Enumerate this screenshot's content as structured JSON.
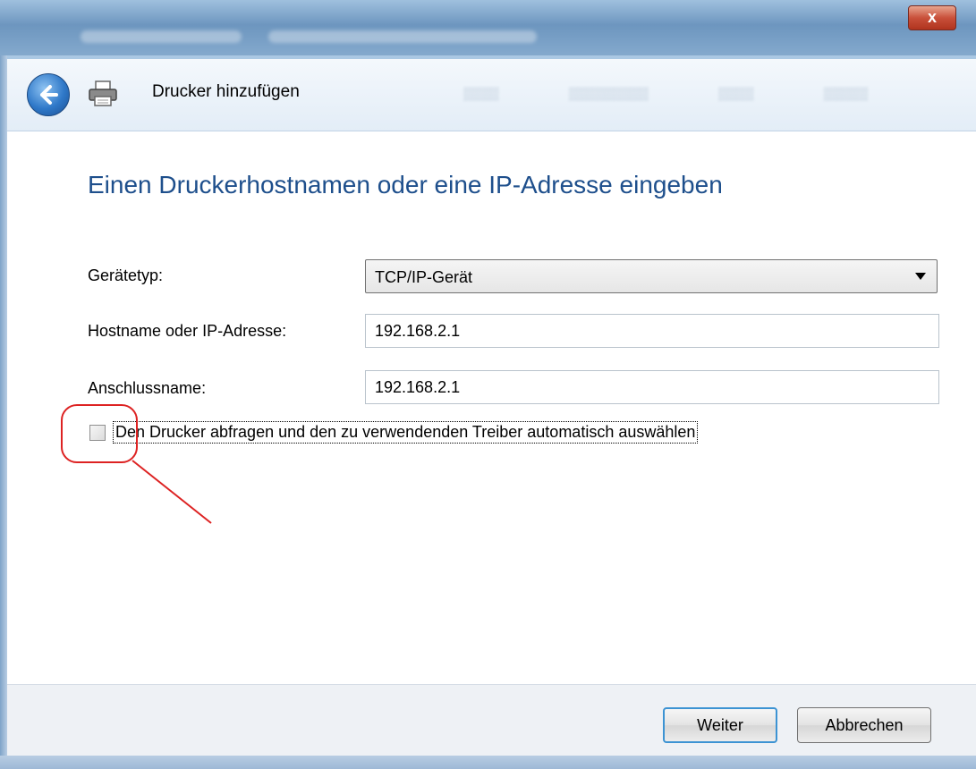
{
  "window": {
    "close_label": "x"
  },
  "nav": {
    "title": "Drucker hinzufügen"
  },
  "main": {
    "heading": "Einen Druckerhostnamen oder eine IP-Adresse eingeben",
    "device_type": {
      "label": "Gerätetyp:",
      "selected": "TCP/IP-Gerät"
    },
    "hostname": {
      "label": "Hostname oder IP-Adresse:",
      "value": "192.168.2.1"
    },
    "port_name": {
      "label": "Anschlussname:",
      "value": "192.168.2.1"
    },
    "query_driver": {
      "label": "Den Drucker abfragen und den zu verwendenden Treiber automatisch auswählen",
      "checked": false
    }
  },
  "footer": {
    "next_label": "Weiter",
    "cancel_label": "Abbrechen"
  },
  "colors": {
    "heading": "#1e4f8c",
    "annotation": "#dd2222",
    "focus_border": "#3c93d3"
  },
  "icons": [
    "close-icon",
    "back-arrow-icon",
    "printer-icon",
    "chevron-down-icon"
  ]
}
